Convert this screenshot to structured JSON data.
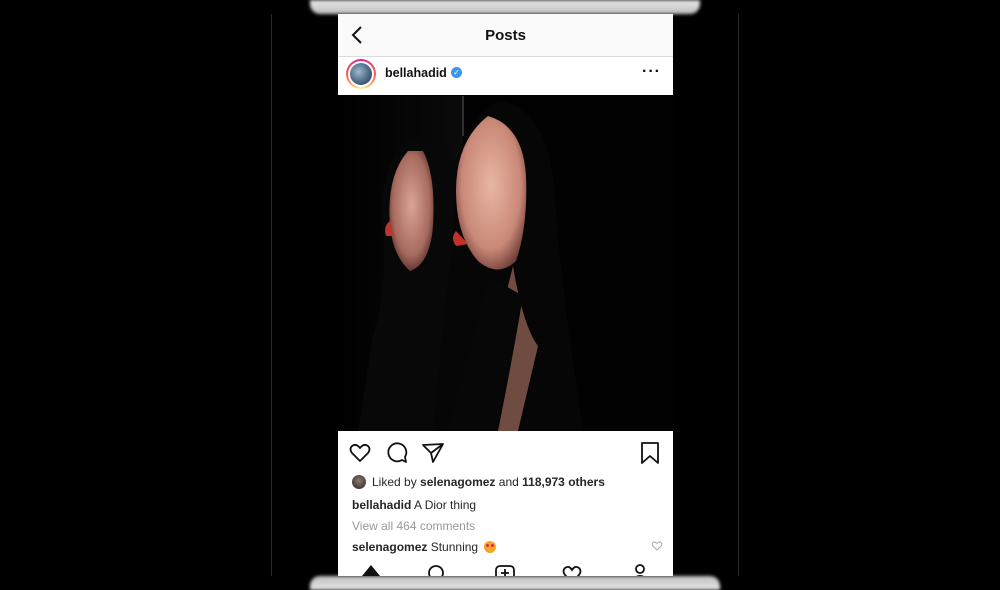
{
  "nav": {
    "title": "Posts",
    "back_icon": "chevron-left-icon"
  },
  "post": {
    "username": "bellahadid",
    "verified": true,
    "more_icon": "more-horizontal-icon",
    "liked_prefix": "Liked by",
    "liked_user": "selenagomez",
    "liked_and": "and",
    "liked_others": "118,973 others",
    "caption_user": "bellahadid",
    "caption_text": "A Dior thing",
    "view_comments": "View all 464 comments",
    "comment_user": "selenagomez",
    "comment_text": "Stunning"
  },
  "actions": {
    "like_icon": "heart-icon",
    "comment_icon": "comment-icon",
    "share_icon": "send-icon",
    "save_icon": "bookmark-icon"
  },
  "tabs": [
    "home-icon",
    "search-icon",
    "new-post-icon",
    "activity-heart-icon",
    "profile-icon"
  ],
  "colors": {
    "verified": "#3897f0",
    "text": "#262626",
    "muted": "#999999"
  }
}
